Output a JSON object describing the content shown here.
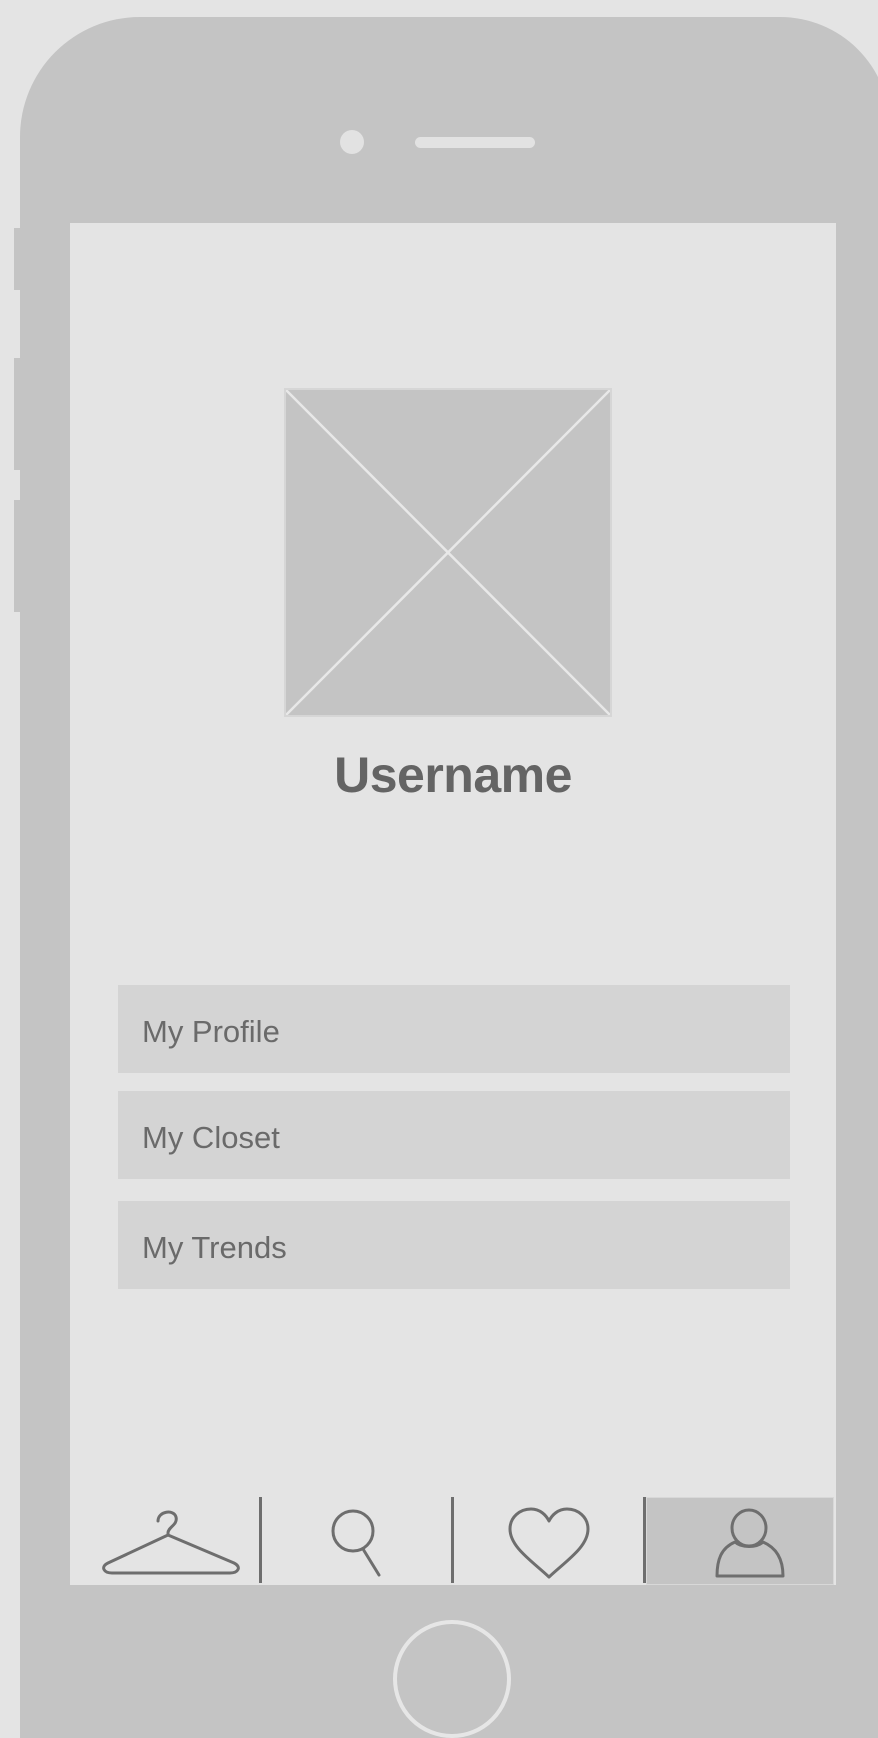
{
  "profile": {
    "username": "Username"
  },
  "menu": {
    "items": [
      {
        "label": "My Profile"
      },
      {
        "label": "My Closet"
      },
      {
        "label": "My Trends"
      }
    ]
  },
  "tabbar": {
    "tabs": [
      {
        "icon": "hanger-icon",
        "active": false
      },
      {
        "icon": "search-icon",
        "active": false
      },
      {
        "icon": "heart-icon",
        "active": false
      },
      {
        "icon": "user-icon",
        "active": true
      }
    ]
  },
  "colors": {
    "frame": "#c4c4c4",
    "screen": "#e4e4e4",
    "menu_item": "#d4d4d4",
    "text": "#646464",
    "active_tab": "#c4c4c4"
  }
}
